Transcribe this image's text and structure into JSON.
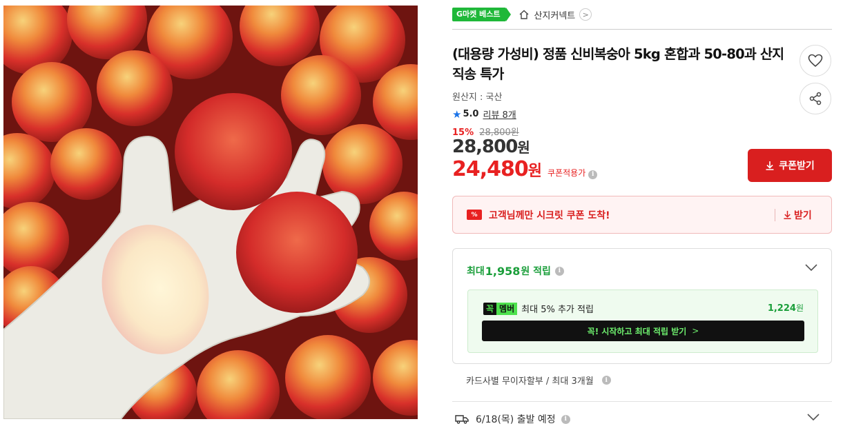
{
  "product_image": {
    "alt": "nectarines-photo"
  },
  "badge": {
    "label": "G마켓 베스트"
  },
  "seller": {
    "name": "산지커넥트",
    "icon": "home-icon"
  },
  "product": {
    "title": "(대용량 가성비) 정품 신비복숭아 5kg 혼합과 50-80과 산지직송 특가",
    "origin": "원산지 : 국산",
    "rating_score": "5.0",
    "review_text": "리뷰 8개",
    "discount_rate": "15%",
    "original_price": "28,800원",
    "price_value": "28,800",
    "price_unit": "원",
    "coupon_price_value": "24,480",
    "coupon_price_unit": "원",
    "coupon_note": "쿠폰적용가"
  },
  "actions": {
    "coupon_button": "쿠폰받기",
    "like_icon": "heart-icon",
    "share_icon": "share-icon"
  },
  "secret_coupon": {
    "message": "고객님께만 시크릿 쿠폰 도착!",
    "action": "받기",
    "icon_text": "%"
  },
  "reward": {
    "prefix": "최대 ",
    "amount": "1,958",
    "suffix": "원 적립",
    "member_k": "꼭",
    "member_m": "멤버",
    "member_text": "최대 5% 추가 적립",
    "member_amount": "1,224",
    "member_unit": "원",
    "member_cta": "꼭! 시작하고 최대 적립 받기",
    "member_cta_arrow": ">"
  },
  "installment": {
    "text": "카드사별 무이자할부 / 최대 3개월"
  },
  "delivery": {
    "text": "6/18(목) 출발 예정"
  },
  "colors": {
    "accent_red": "#d91f1f",
    "green": "#1fb839",
    "member_green": "#4ee14e"
  }
}
